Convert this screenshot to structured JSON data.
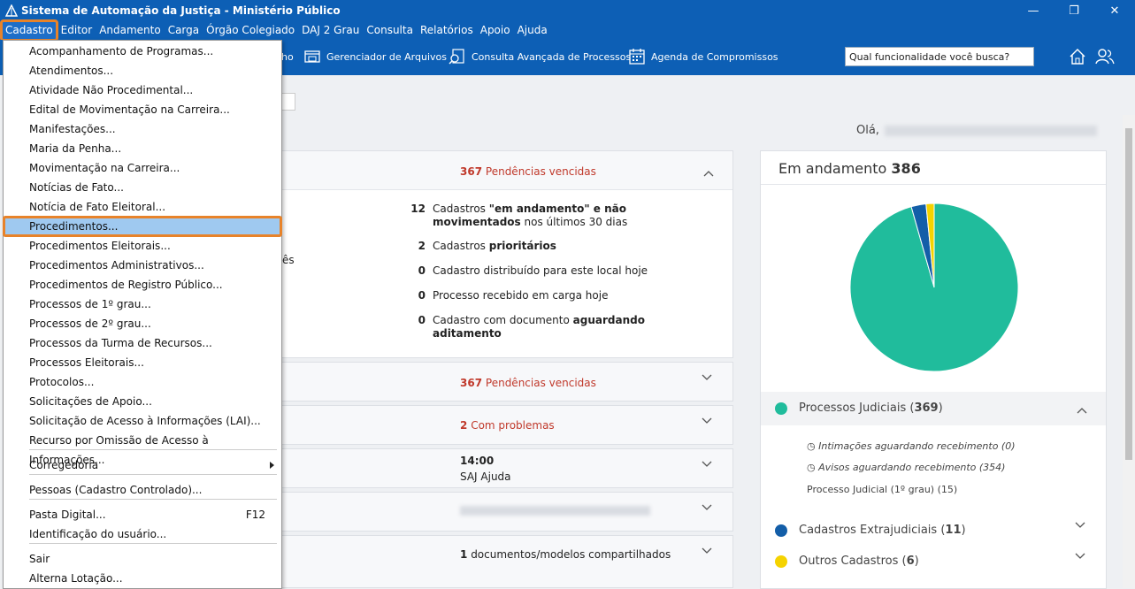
{
  "window": {
    "title": "Sistema de Automação da Justiça - Ministério Público"
  },
  "menubar": [
    "Cadastro",
    "Editor",
    "Andamento",
    "Carga",
    "Órgão Colegiado",
    "DAJ 2 Grau",
    "Consulta",
    "Relatórios",
    "Apoio",
    "Ajuda"
  ],
  "toolbar": {
    "partial_label": "ho",
    "file_manager": "Gerenciador de Arquivos",
    "advanced_search": "Consulta Avançada de Processos",
    "agenda": "Agenda de Compromissos",
    "search_placeholder": "Qual funcionalidade você busca?"
  },
  "greeting": "Olá,",
  "cards": {
    "card1_pend_num": "367",
    "card1_pend_txt": "Pendências vencidas",
    "partial_left": "ês",
    "stats": [
      {
        "num": "12",
        "pre": "Cadastros ",
        "bold": "\"em andamento\" e não movimentados",
        "post": " nos últimos 30 dias"
      },
      {
        "num": "2",
        "pre": "Cadastros ",
        "bold": "prioritários",
        "post": ""
      },
      {
        "num": "0",
        "pre": "Cadastro distribuído para este local hoje",
        "bold": "",
        "post": ""
      },
      {
        "num": "0",
        "pre": "Processo recebido em carga hoje",
        "bold": "",
        "post": ""
      },
      {
        "num": "0",
        "pre": "Cadastro com documento ",
        "bold": "aguardando aditamento",
        "post": ""
      }
    ],
    "card2_pend_num": "367",
    "card2_pend_txt": "Pendências vencidas",
    "card3_num": "2",
    "card3_txt": "Com problemas",
    "card4_time": "14:00",
    "card4_txt": "SAJ Ajuda",
    "card6_num": "1",
    "card6_txt": "documentos/modelos compartilhados"
  },
  "chart_panel": {
    "title": "Em andamento",
    "total": "386",
    "legend": [
      {
        "label": "Processos Judiciais",
        "count": "369",
        "color": "#20bc9c"
      },
      {
        "label": "Cadastros Extrajudiciais",
        "count": "11",
        "color": "#135ea8"
      },
      {
        "label": "Outros Cadastros",
        "count": "6",
        "color": "#f5d300"
      }
    ],
    "sub_items": [
      "Intimações aguardando recebimento (0)",
      "Avisos aguardando recebimento (354)",
      "Processo Judicial (1º grau) (15)"
    ]
  },
  "chart_data": {
    "type": "pie",
    "categories": [
      "Processos Judiciais",
      "Cadastros Extrajudiciais",
      "Outros Cadastros"
    ],
    "values": [
      369,
      11,
      6
    ],
    "colors": [
      "#20bc9c",
      "#135ea8",
      "#f5d300"
    ]
  },
  "dropdown": [
    {
      "label": "Acompanhamento de Programas..."
    },
    {
      "label": "Atendimentos..."
    },
    {
      "label": "Atividade Não Procedimental..."
    },
    {
      "label": "Edital de Movimentação na Carreira..."
    },
    {
      "label": "Manifestações..."
    },
    {
      "label": "Maria da Penha..."
    },
    {
      "label": "Movimentação na Carreira..."
    },
    {
      "label": "Notícias de Fato..."
    },
    {
      "label": "Notícia de Fato Eleitoral..."
    },
    {
      "label": "Procedimentos..."
    },
    {
      "label": "Procedimentos Eleitorais..."
    },
    {
      "label": "Procedimentos Administrativos..."
    },
    {
      "label": "Procedimentos de Registro Público..."
    },
    {
      "label": "Processos de 1º grau..."
    },
    {
      "label": "Processos de 2º grau..."
    },
    {
      "label": "Processos da Turma de Recursos..."
    },
    {
      "label": "Processos Eleitorais..."
    },
    {
      "label": "Protocolos..."
    },
    {
      "label": "Solicitações de Apoio..."
    },
    {
      "label": "Solicitação de Acesso à Informações (LAI)..."
    },
    {
      "label": "Recurso por Omissão de Acesso à Informações..."
    },
    {
      "label": "Corregedoria"
    },
    {
      "label": "Pessoas (Cadastro Controlado)..."
    },
    {
      "label": "Pasta Digital...",
      "shortcut": "F12"
    },
    {
      "label": "Identificação do usuário..."
    },
    {
      "label": "Sair"
    },
    {
      "label": "Alterna Lotação..."
    }
  ]
}
